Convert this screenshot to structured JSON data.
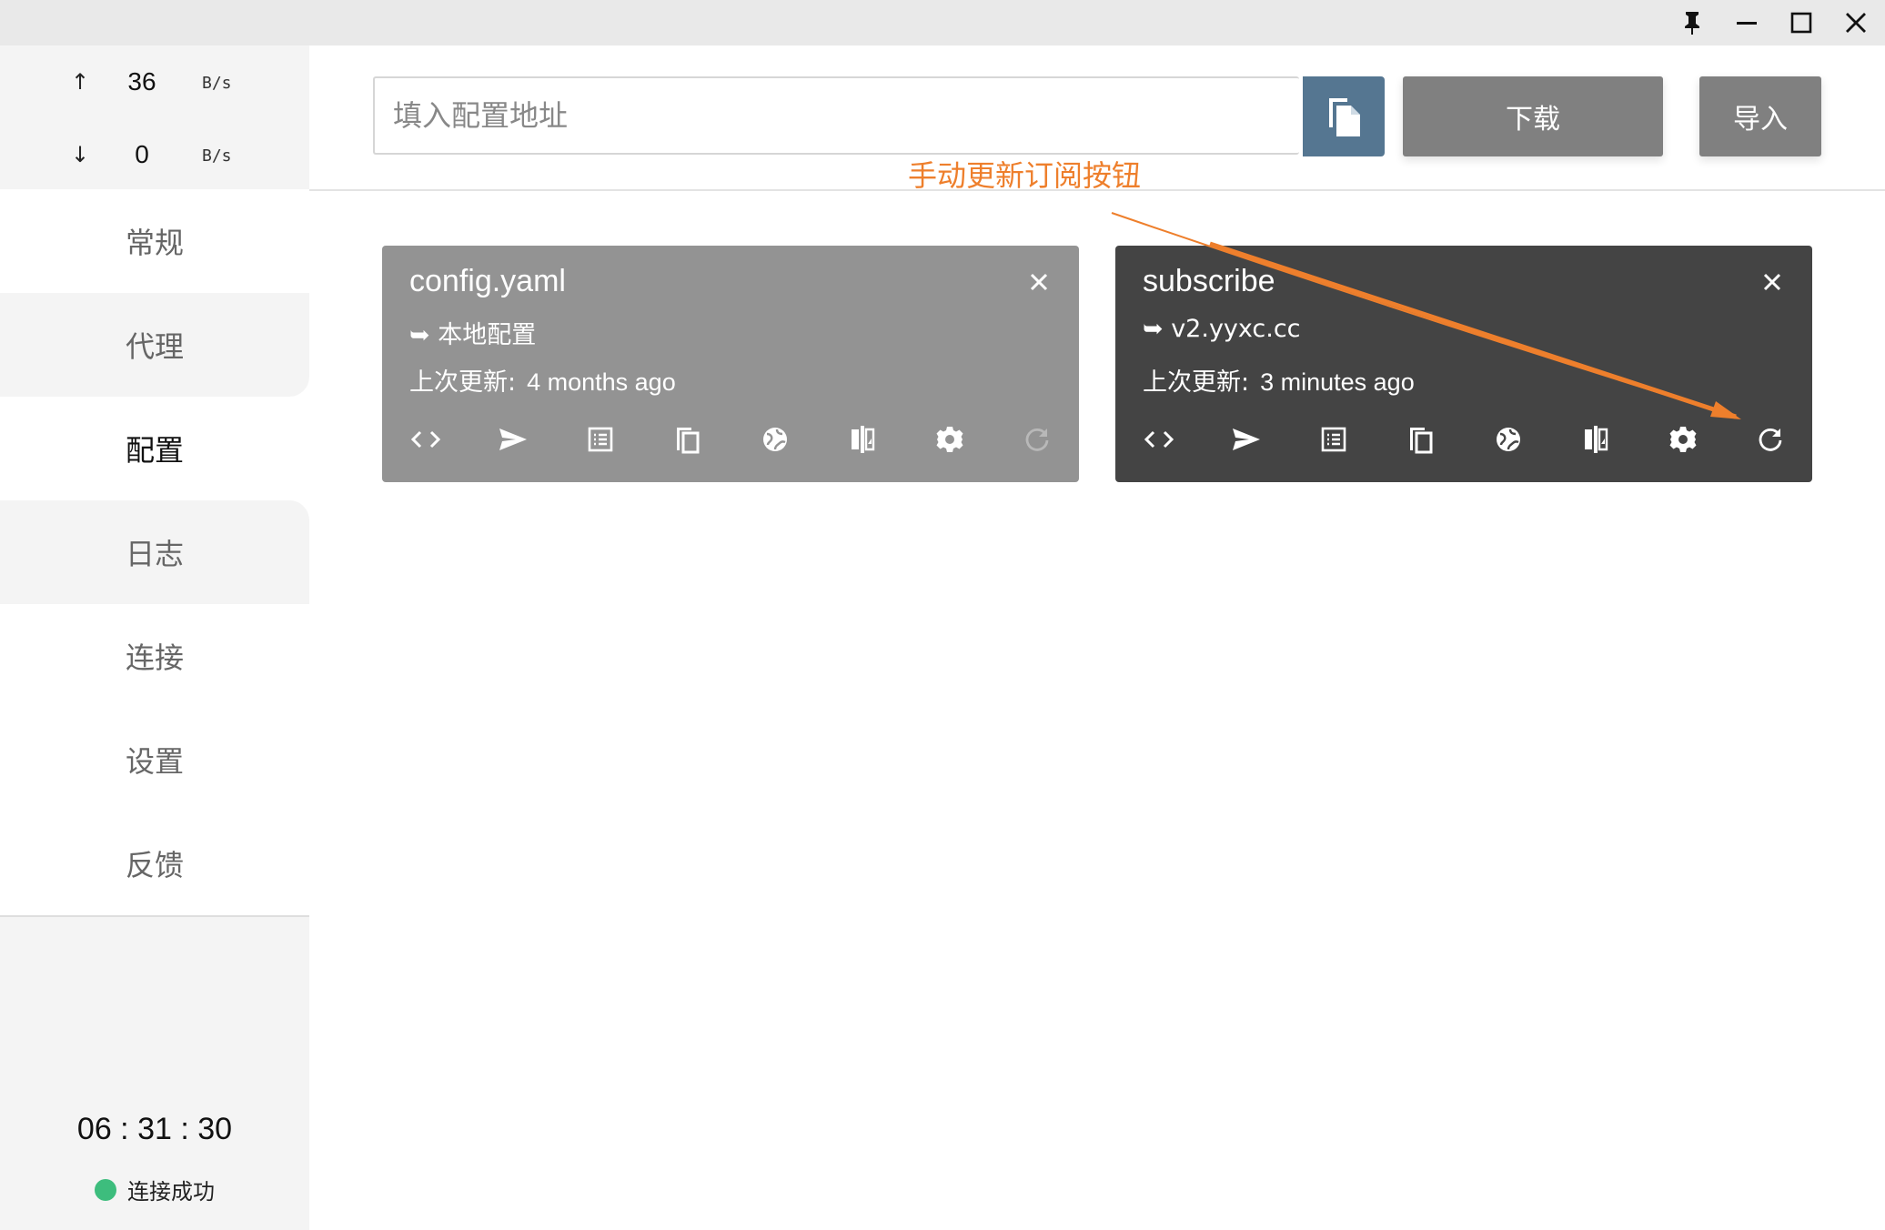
{
  "window": {
    "buttons": [
      "pin-icon",
      "minimize-icon",
      "maximize-icon",
      "close-icon"
    ]
  },
  "sidebar": {
    "traffic": {
      "up": {
        "arrow": "↑",
        "value": "36",
        "unit": "B/s"
      },
      "down": {
        "arrow": "↓",
        "value": "0",
        "unit": "B/s"
      }
    },
    "nav": [
      {
        "label": "常规",
        "active": false
      },
      {
        "label": "代理",
        "active": false
      },
      {
        "label": "配置",
        "active": true
      },
      {
        "label": "日志",
        "active": false
      },
      {
        "label": "连接",
        "active": false
      },
      {
        "label": "设置",
        "active": false
      },
      {
        "label": "反馈",
        "active": false
      }
    ],
    "clock": "06 : 31 : 30",
    "status": {
      "label": "连接成功",
      "color": "#3dbd7d"
    }
  },
  "toolbar": {
    "url_placeholder": "填入配置地址",
    "url_value": "",
    "download_label": "下载",
    "import_label": "导入",
    "paste_icon": "paste-icon",
    "accent": "#557691"
  },
  "annotation": {
    "text": "手动更新订阅按钮",
    "color": "#ee7f2c"
  },
  "profiles": [
    {
      "name": "config.yaml",
      "source": "➥ 本地配置",
      "updated_label": "上次更新:",
      "updated_time": "4 months ago",
      "selected": false,
      "background": "#939393",
      "refresh_enabled": false
    },
    {
      "name": "subscribe",
      "source": "➥ v2.yyxc.cc",
      "updated_label": "上次更新:",
      "updated_time": "3 minutes ago",
      "selected": true,
      "background": "#444444",
      "refresh_enabled": true
    }
  ],
  "card_actions": [
    "code-icon",
    "send-icon",
    "list-icon",
    "copy-icon",
    "globe-icon",
    "compare-icon",
    "gear-icon",
    "refresh-icon"
  ]
}
